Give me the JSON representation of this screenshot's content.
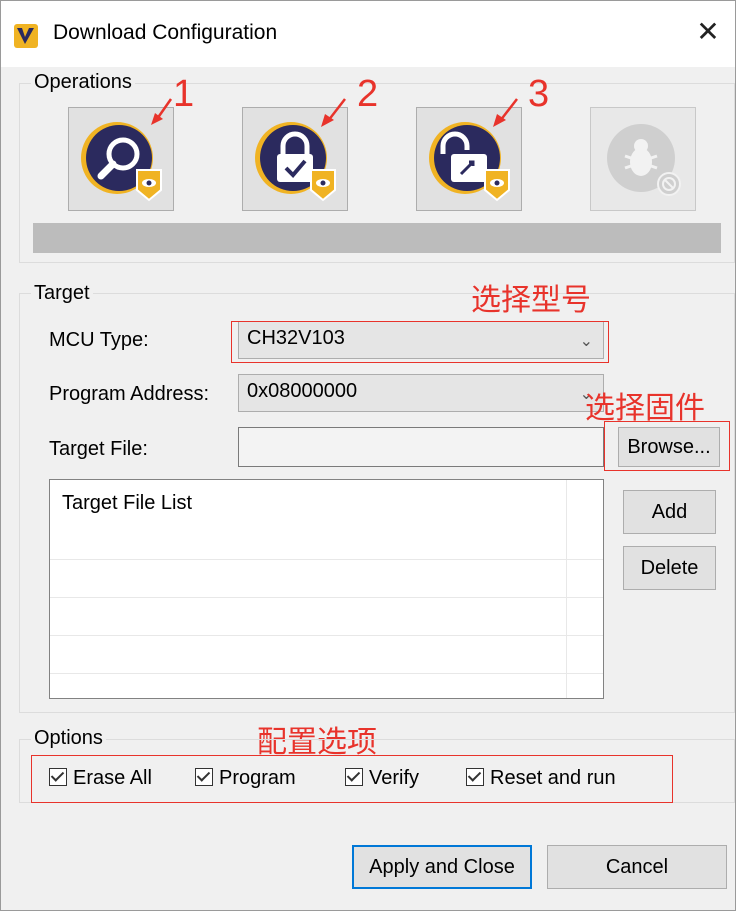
{
  "window": {
    "title": "Download Configuration",
    "close_glyph": "✕"
  },
  "operations": {
    "label": "Operations",
    "buttons": [
      {
        "name": "query-button",
        "icon": "search-eye-icon",
        "enabled": true,
        "annotation": "1"
      },
      {
        "name": "protect-button",
        "icon": "lock-eye-icon",
        "enabled": true,
        "annotation": "2"
      },
      {
        "name": "unprotect-button",
        "icon": "unlock-eye-icon",
        "enabled": true,
        "annotation": "3"
      },
      {
        "name": "debug-button",
        "icon": "bug-disabled-icon",
        "enabled": false
      }
    ]
  },
  "target": {
    "label": "Target",
    "mcu_type_label": "MCU Type:",
    "mcu_type_value": "CH32V103",
    "program_address_label": "Program Address:",
    "program_address_value": "0x08000000",
    "target_file_label": "Target File:",
    "target_file_value": "",
    "browse_label": "Browse...",
    "file_list_header": "Target File List",
    "add_label": "Add",
    "delete_label": "Delete"
  },
  "options": {
    "label": "Options",
    "items": [
      {
        "label": "Erase All",
        "checked": true
      },
      {
        "label": "Program",
        "checked": true
      },
      {
        "label": "Verify",
        "checked": true
      },
      {
        "label": "Reset and run",
        "checked": true
      }
    ]
  },
  "footer": {
    "apply_label": "Apply and Close",
    "cancel_label": "Cancel"
  },
  "annotations": {
    "num1": "1",
    "num2": "2",
    "num3": "3",
    "select_model": "选择型号",
    "select_firmware": "选择固件",
    "config_options": "配置选项",
    "color": "#e8332b"
  },
  "colors": {
    "accent_blue": "#0078d7",
    "icon_navy": "#2b2a5e",
    "icon_gold": "#f0b323"
  }
}
